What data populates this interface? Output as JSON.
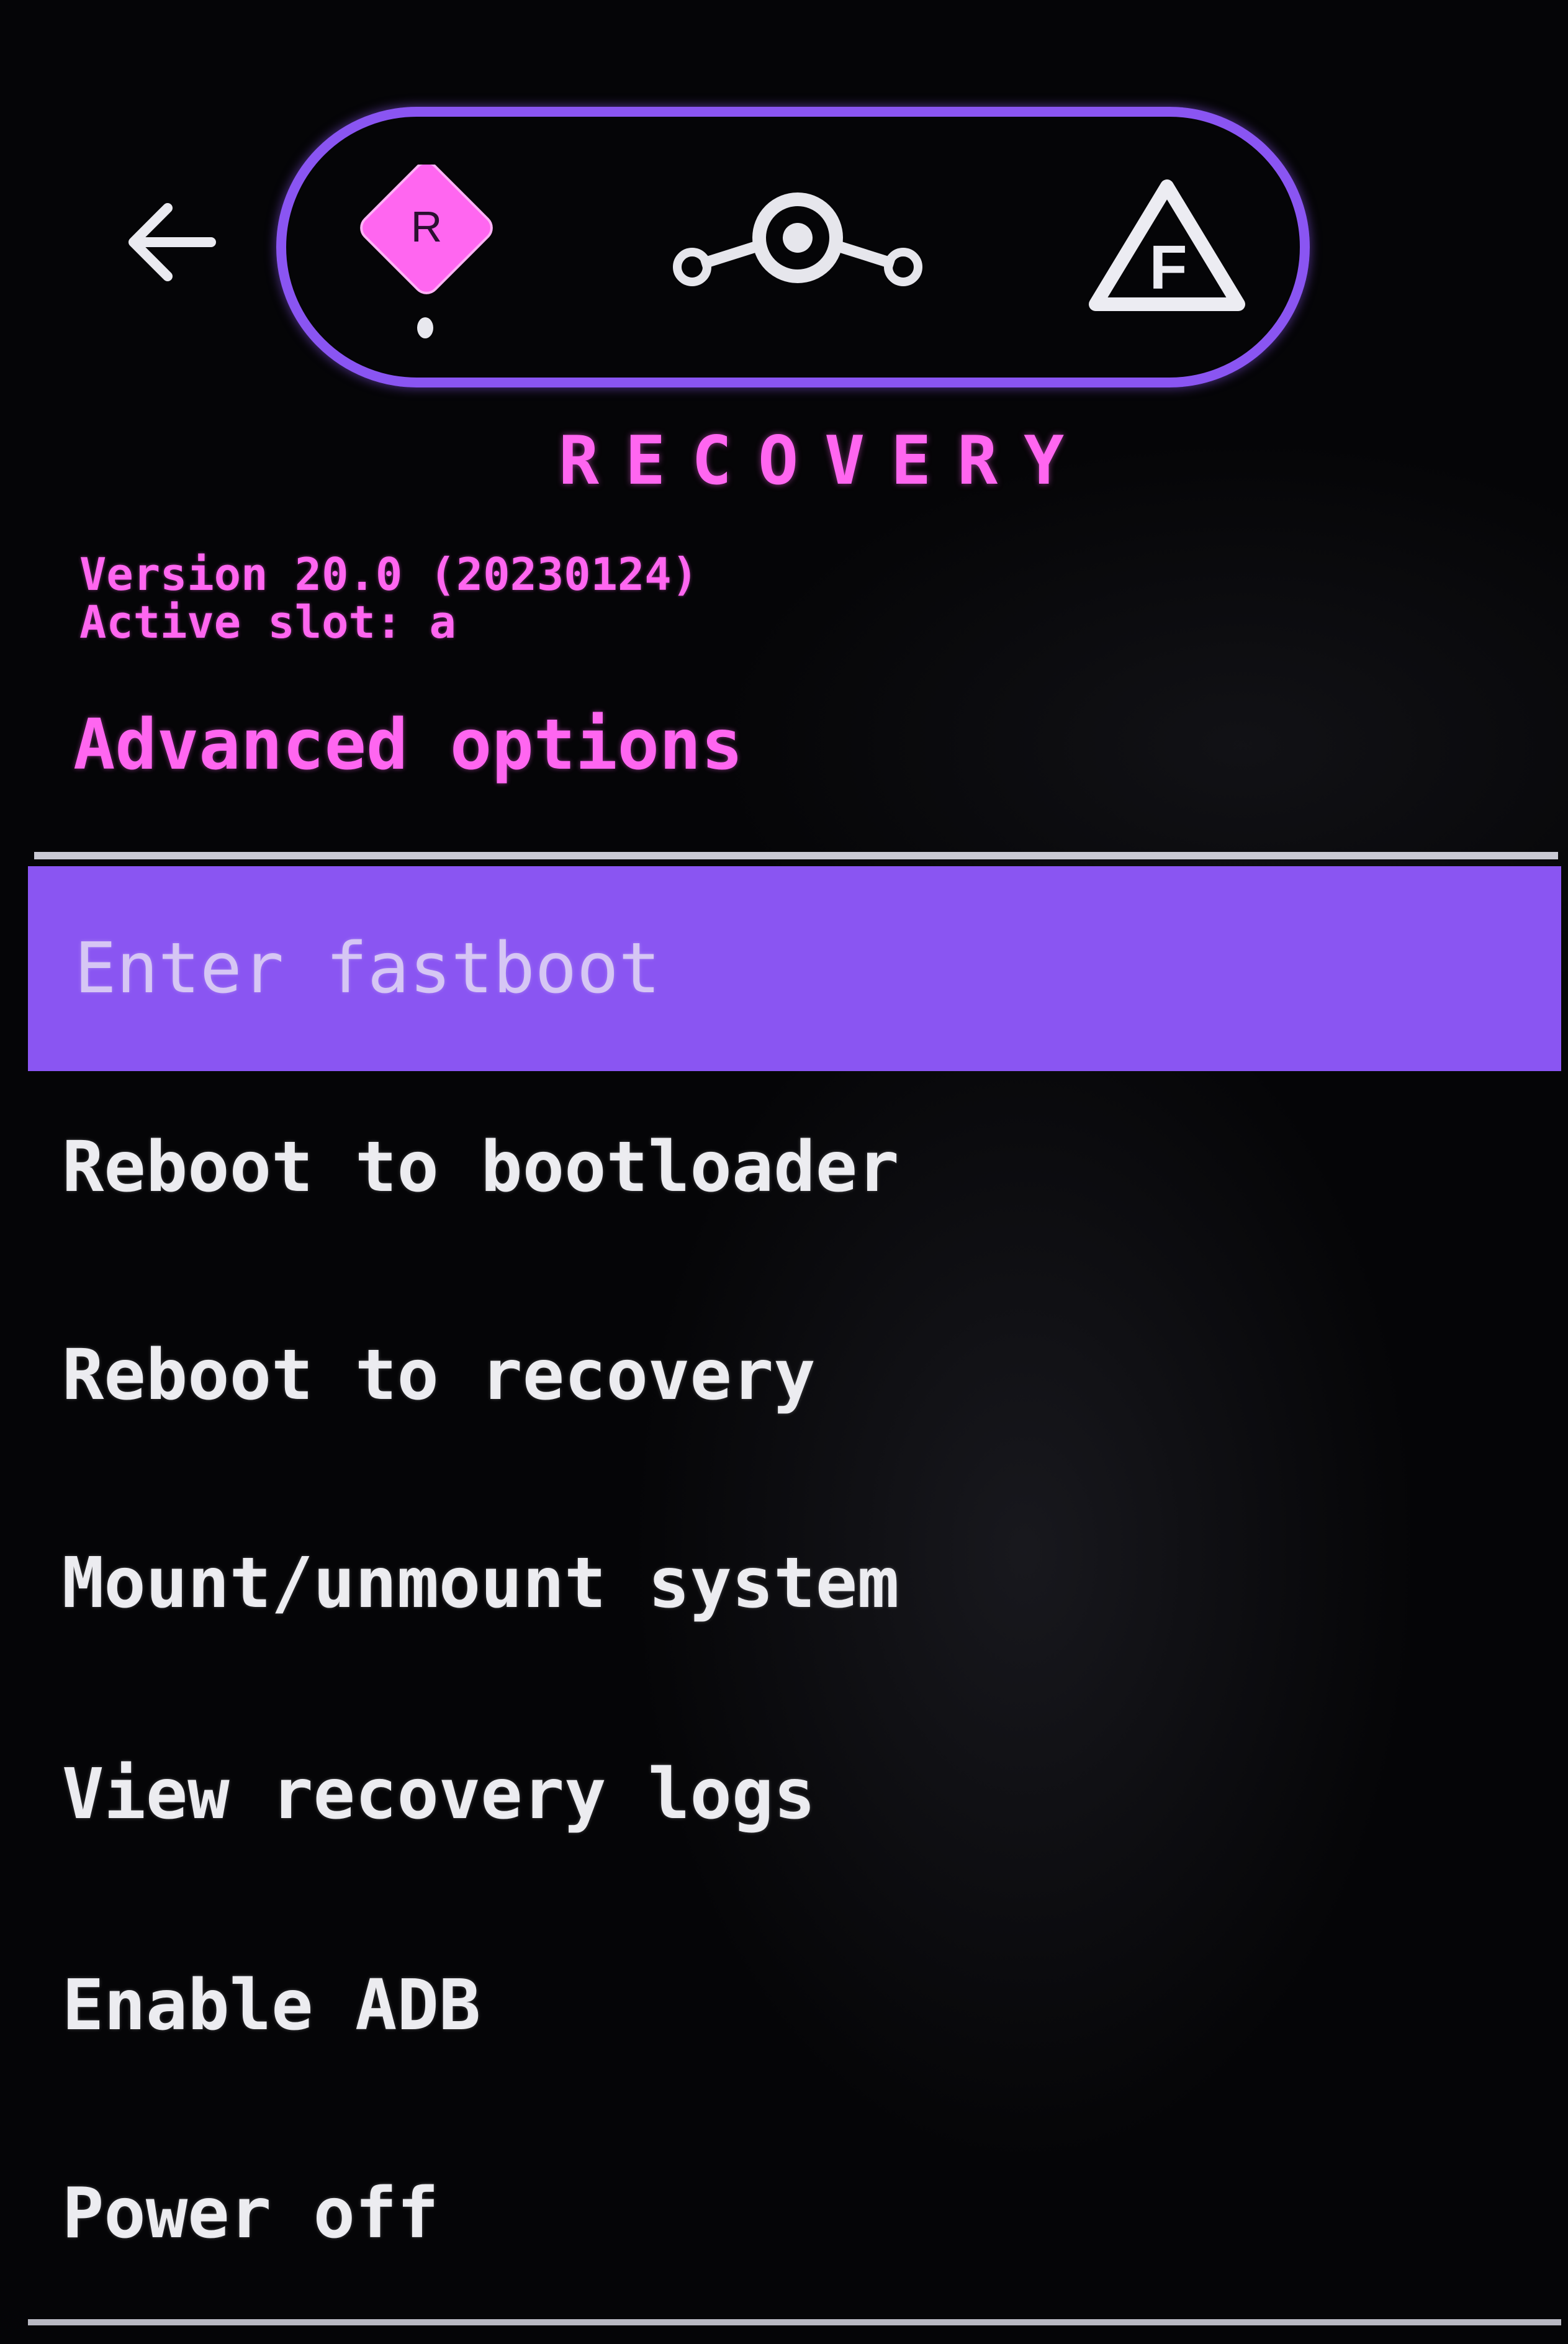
{
  "header": {
    "back_icon": "arrow-left-icon",
    "modes": [
      {
        "name": "recovery",
        "icon": "diamond-r-icon",
        "glyph": "R",
        "active": true
      },
      {
        "name": "lineage",
        "icon": "lineage-logo-icon",
        "active": false
      },
      {
        "name": "fastboot",
        "icon": "triangle-f-icon",
        "glyph": "F",
        "active": false
      }
    ],
    "title": "RECOVERY"
  },
  "info": {
    "version": "Version 20.0 (20230124)",
    "slot": "Active slot: a"
  },
  "section": {
    "title": "Advanced options"
  },
  "menu": {
    "items": [
      {
        "label": "Enter fastboot",
        "selected": true
      },
      {
        "label": "Reboot to bootloader",
        "selected": false
      },
      {
        "label": "Reboot to recovery",
        "selected": false
      },
      {
        "label": "Mount/unmount system",
        "selected": false
      },
      {
        "label": "View recovery logs",
        "selected": false
      },
      {
        "label": "Enable ADB",
        "selected": false
      },
      {
        "label": "Power off",
        "selected": false
      }
    ]
  },
  "colors": {
    "accent": "#8a55f2",
    "pink": "#ff66f0",
    "text": "#ececf0",
    "background": "#050507"
  }
}
